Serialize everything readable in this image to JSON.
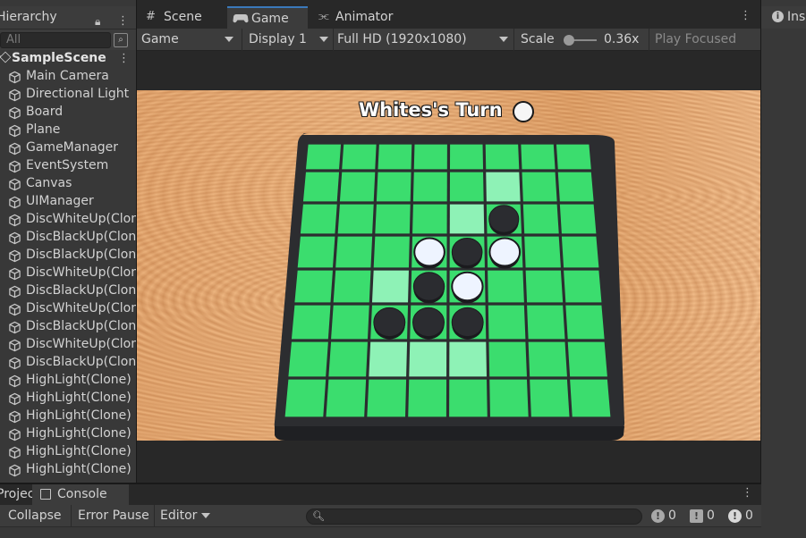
{
  "hierarchy": {
    "tab_label": "Hierarchy",
    "search_placeholder": "All",
    "scene_name": "SampleScene",
    "items": [
      "Main Camera",
      "Directional Light",
      "Board",
      "Plane",
      "GameManager",
      "EventSystem",
      "Canvas",
      "UIManager",
      "DiscWhiteUp(Clone)",
      "DiscBlackUp(Clone)",
      "DiscBlackUp(Clone)",
      "DiscWhiteUp(Clone)",
      "DiscBlackUp(Clone)",
      "DiscWhiteUp(Clone)",
      "DiscBlackUp(Clone)",
      "DiscWhiteUp(Clone)",
      "DiscBlackUp(Clone)",
      "HighLight(Clone)",
      "HighLight(Clone)",
      "HighLight(Clone)",
      "HighLight(Clone)",
      "HighLight(Clone)",
      "HighLight(Clone)"
    ]
  },
  "tabs": {
    "scene": "Scene",
    "game": "Game",
    "animator": "Animator",
    "inspector": "Inspector"
  },
  "game_toolbar": {
    "mode": "Game",
    "display": "Display 1",
    "resolution": "Full HD (1920x1080)",
    "scale_label": "Scale",
    "scale_value": "0.36x",
    "play_focused": "Play Focused"
  },
  "game_view": {
    "turn_text": "Whites's Turn",
    "turn_color": "white",
    "board_size": 8,
    "colors": {
      "cell": "#3bdd6e",
      "highlight": "#8ef2b6",
      "frame": "#2c2d30",
      "black_disc": "#2b2c30",
      "white_disc": "#eef4ff"
    },
    "discs": [
      {
        "row": 2,
        "col": 5,
        "color": "black"
      },
      {
        "row": 3,
        "col": 3,
        "color": "white"
      },
      {
        "row": 3,
        "col": 4,
        "color": "black"
      },
      {
        "row": 3,
        "col": 5,
        "color": "white"
      },
      {
        "row": 4,
        "col": 3,
        "color": "black"
      },
      {
        "row": 4,
        "col": 4,
        "color": "white"
      },
      {
        "row": 5,
        "col": 2,
        "color": "black"
      },
      {
        "row": 5,
        "col": 3,
        "color": "black"
      },
      {
        "row": 5,
        "col": 4,
        "color": "black"
      }
    ],
    "highlights": [
      {
        "row": 1,
        "col": 5
      },
      {
        "row": 2,
        "col": 4
      },
      {
        "row": 4,
        "col": 2
      },
      {
        "row": 6,
        "col": 2
      },
      {
        "row": 6,
        "col": 3
      },
      {
        "row": 6,
        "col": 4
      }
    ]
  },
  "console": {
    "project_tab": "Project",
    "console_tab": "Console",
    "collapse": "Collapse",
    "error_pause": "Error Pause",
    "editor": "Editor",
    "info_count": "0",
    "warning_count": "0",
    "error_count": "0"
  }
}
